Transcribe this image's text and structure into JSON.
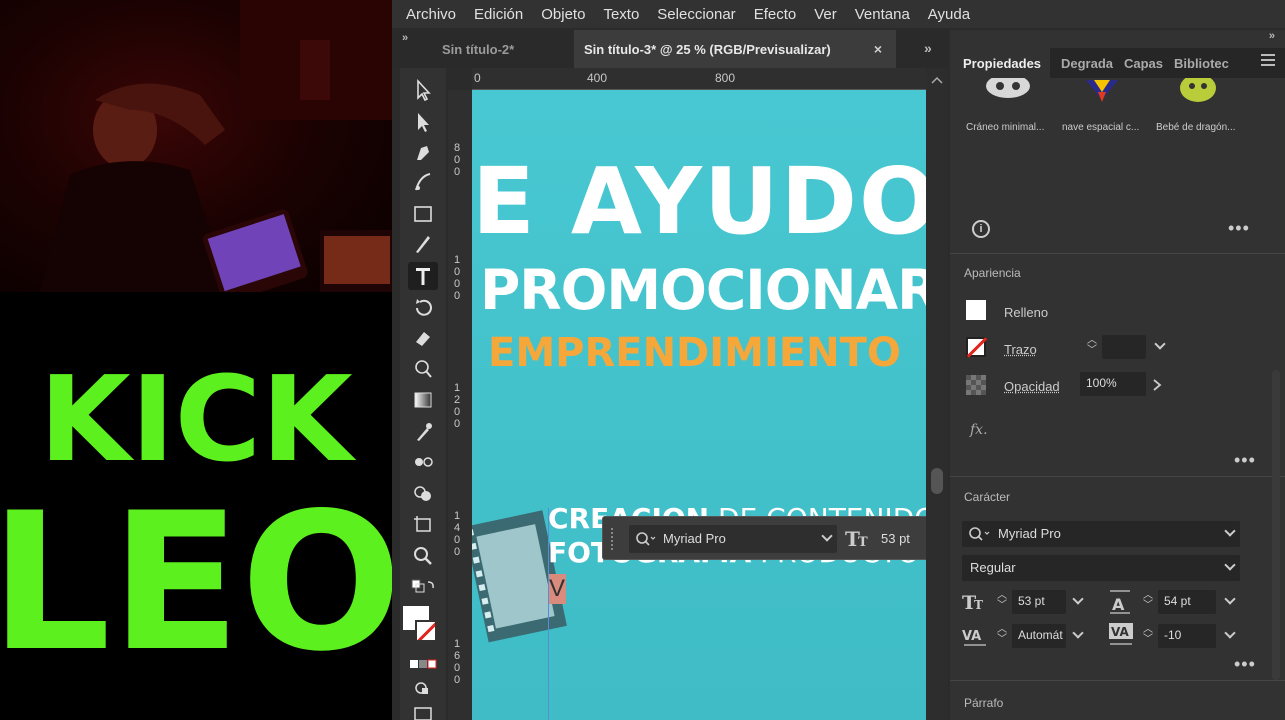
{
  "stream": {
    "logo_line1": "KICK",
    "logo_line2": "LEO",
    "logo_color": "#5cf01e"
  },
  "menu": [
    "Archivo",
    "Edición",
    "Objeto",
    "Texto",
    "Seleccionar",
    "Efecto",
    "Ver",
    "Ventana",
    "Ayuda"
  ],
  "tabs": {
    "inactive": "Sin título-2*",
    "active": "Sin título-3* @ 25 % (RGB/Previsualizar)",
    "close": "×",
    "overflow": "»"
  },
  "rulers": {
    "top": [
      "0",
      "400",
      "800"
    ],
    "left": [
      [
        "8",
        "0",
        "0"
      ],
      [
        "1",
        "0",
        "0",
        "0"
      ],
      [
        "1",
        "2",
        "0",
        "0"
      ],
      [
        "1",
        "4",
        "0",
        "0"
      ],
      [
        "1",
        "6",
        "0",
        "0"
      ]
    ]
  },
  "artboard": {
    "headline": "E AYUDO",
    "line2": "PROMOCIONAR",
    "line3": "EMPRENDIMIENTO",
    "text1_bold": "CREACION",
    "text1_rest": " DE CONTENIDO",
    "text2_bold": "FOTOGRAFÍA",
    "text2_rest": " PRODUCTO",
    "cursor_text": "V",
    "bg_color": "#46c6d0",
    "accent_color": "#f5a73a"
  },
  "context_bar": {
    "font": "Myriad Pro",
    "size": "53 pt",
    "more": "•••"
  },
  "panel": {
    "tabs": [
      "Propiedades",
      "Degrada",
      "Capas",
      "Bibliotec"
    ],
    "thumbs": [
      "Cráneo minimal...",
      "nave espacial c...",
      "Bebé de dragón..."
    ],
    "appearance": {
      "title": "Apariencia",
      "fill": "Relleno",
      "stroke": "Trazo",
      "opacity_label": "Opacidad",
      "opacity_value": "100%",
      "fx": "fx."
    },
    "character": {
      "title": "Carácter",
      "font": "Myriad Pro",
      "style": "Regular",
      "size": "53 pt",
      "leading": "54 pt",
      "kerning": "Automát",
      "tracking": "-10"
    },
    "paragraph_title": "Párrafo",
    "more": "•••"
  }
}
